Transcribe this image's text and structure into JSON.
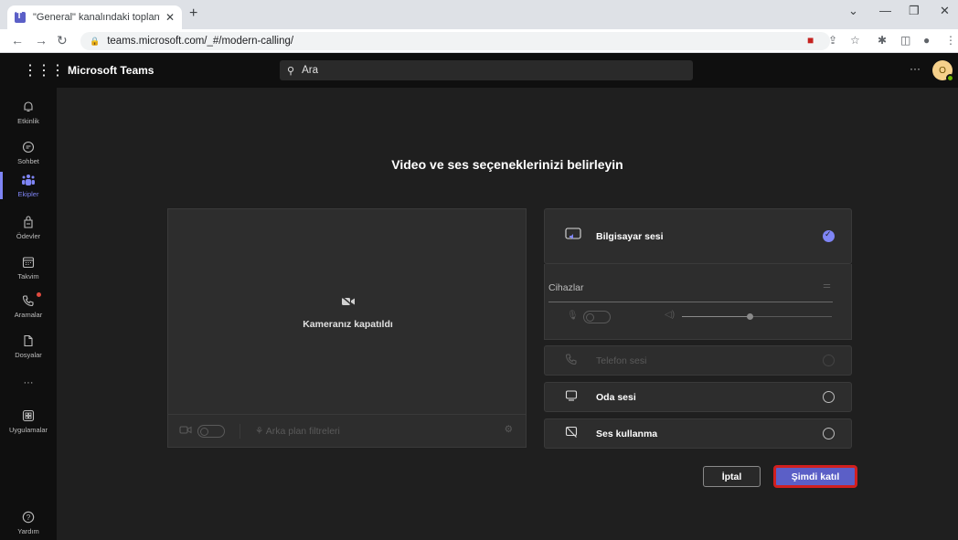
{
  "browser": {
    "tab_title": "\"General\" kanalındaki toplantı (T",
    "url": "teams.microsoft.com/_#/modern-calling/"
  },
  "teams": {
    "brand": "Microsoft Teams",
    "search_placeholder": "Ara",
    "avatar_initial": "O",
    "more_label": "···"
  },
  "rail": {
    "items": [
      {
        "label": "Etkinlik",
        "icon": "bell-icon"
      },
      {
        "label": "Sohbet",
        "icon": "chat-icon"
      },
      {
        "label": "Ekipler",
        "icon": "teams-icon",
        "active": true
      },
      {
        "label": "Ödevler",
        "icon": "assignments-icon"
      },
      {
        "label": "Takvim",
        "icon": "calendar-icon"
      },
      {
        "label": "Aramalar",
        "icon": "phone-icon"
      },
      {
        "label": "Dosyalar",
        "icon": "file-icon"
      },
      {
        "label": "···",
        "icon": "more-icon"
      },
      {
        "label": "Uygulamalar",
        "icon": "apps-icon"
      },
      {
        "label": "Yardım",
        "icon": "help-icon"
      }
    ]
  },
  "prejoin": {
    "heading": "Video ve ses seçeneklerinizi belirleyin",
    "camera_off_text": "Kameranız kapatıldı",
    "background_filters": "Arka plan filtreleri",
    "audio_options": [
      {
        "label": "Bilgisayar sesi",
        "selected": true,
        "disabled": false
      },
      {
        "label": "Telefon sesi",
        "selected": false,
        "disabled": true
      },
      {
        "label": "Oda sesi",
        "selected": false,
        "disabled": false
      },
      {
        "label": "Ses kullanma",
        "selected": false,
        "disabled": false
      }
    ],
    "devices_label": "Cihazlar",
    "speaker_volume": 0.45,
    "cancel_label": "İptal",
    "join_label": "Şimdi katıl"
  },
  "colors": {
    "accent": "#5b5fc7",
    "accent_light": "#7f85f5",
    "background": "#1f1f1f",
    "panel": "#2d2d2d",
    "highlight_border": "#d11f1f"
  }
}
